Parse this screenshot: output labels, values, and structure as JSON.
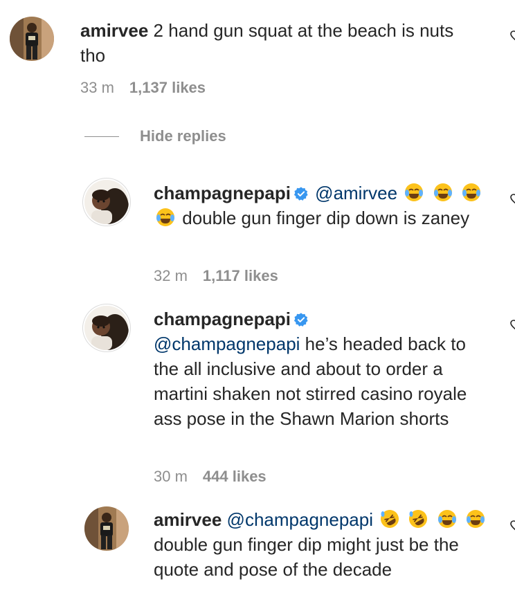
{
  "comments": [
    {
      "username": "amirvee",
      "verified": false,
      "mention": "",
      "emojis_before": [],
      "text": "2 hand gun squat at the beach is nuts tho",
      "time": "33 m",
      "likes": "1,137 likes"
    },
    {
      "username": "champagnepapi",
      "verified": true,
      "mention": "@amirvee",
      "emojis": [
        "joy-emoji",
        "joy-emoji",
        "joy-emoji",
        "joy-emoji"
      ],
      "text": "double gun finger dip down is zaney",
      "time": "32 m",
      "likes": "1,117 likes"
    },
    {
      "username": "champagnepapi",
      "verified": true,
      "mention": "@champagnepapi",
      "text": "he’s headed back to the all inclusive and about to order a martini shaken not stirred casino royale ass pose in the Shawn Marion shorts",
      "time": "30 m",
      "likes": "444 likes"
    },
    {
      "username": "amirvee",
      "verified": false,
      "mention": "@champagnepapi",
      "emojis": [
        "rofl-emoji",
        "rofl-emoji",
        "joy-emoji",
        "joy-emoji"
      ],
      "text": "double gun finger dip might just be the quote and pose of the decade"
    }
  ],
  "replies_toggle": {
    "label": "Hide replies"
  },
  "colors": {
    "mention": "#00376b",
    "meta": "#8e8e8e",
    "verified": "#3897f0",
    "emoji_face": "#fcc21b"
  }
}
